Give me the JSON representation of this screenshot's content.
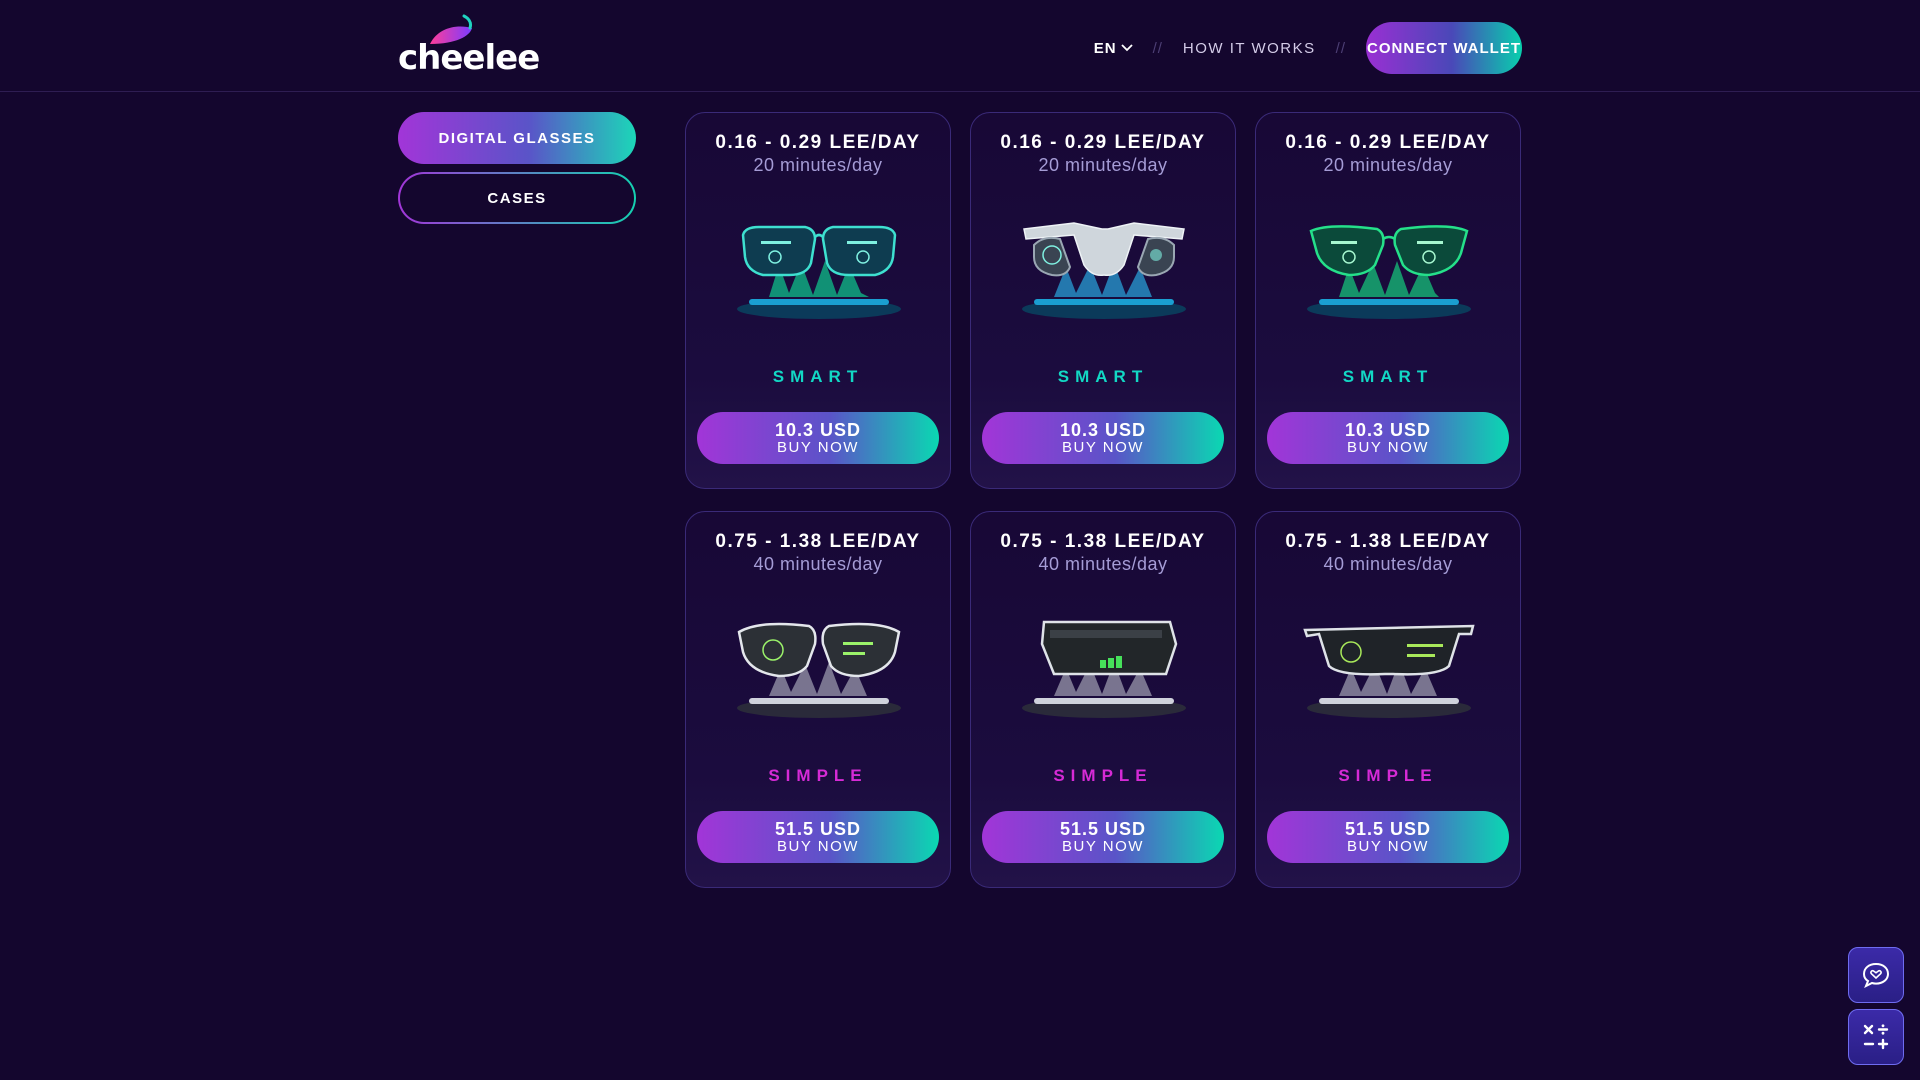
{
  "brand": {
    "name": "cheelee"
  },
  "header": {
    "lang": "EN",
    "separator": "//",
    "how_it_works": "HOW IT WORKS",
    "connect_wallet": "CONNECT WALLET"
  },
  "sidebar": {
    "items": [
      {
        "label": "DIGITAL GLASSES",
        "active": true
      },
      {
        "label": "CASES",
        "active": false
      }
    ]
  },
  "cards": [
    {
      "rate": "0.16 - 0.29 LEE/DAY",
      "time": "20 minutes/day",
      "tier": "SMART",
      "price": "10.3 USD",
      "buy": "BUY NOW"
    },
    {
      "rate": "0.16 - 0.29 LEE/DAY",
      "time": "20 minutes/day",
      "tier": "SMART",
      "price": "10.3 USD",
      "buy": "BUY NOW"
    },
    {
      "rate": "0.16 - 0.29 LEE/DAY",
      "time": "20 minutes/day",
      "tier": "SMART",
      "price": "10.3 USD",
      "buy": "BUY NOW"
    },
    {
      "rate": "0.75 - 1.38 LEE/DAY",
      "time": "40 minutes/day",
      "tier": "SIMPLE",
      "price": "51.5 USD",
      "buy": "BUY NOW"
    },
    {
      "rate": "0.75 - 1.38 LEE/DAY",
      "time": "40 minutes/day",
      "tier": "SIMPLE",
      "price": "51.5 USD",
      "buy": "BUY NOW"
    },
    {
      "rate": "0.75 - 1.38 LEE/DAY",
      "time": "40 minutes/day",
      "tier": "SIMPLE",
      "price": "51.5 USD",
      "buy": "BUY NOW"
    }
  ],
  "floating": {
    "chat_icon": "chat-heart-icon",
    "calculator_icon": "calculator-icon"
  },
  "colors": {
    "background": "#14062e",
    "smart": "#12d8c4",
    "simple": "#d62ad6",
    "gradient_start": "#a235d8",
    "gradient_end": "#0ad8b2"
  }
}
